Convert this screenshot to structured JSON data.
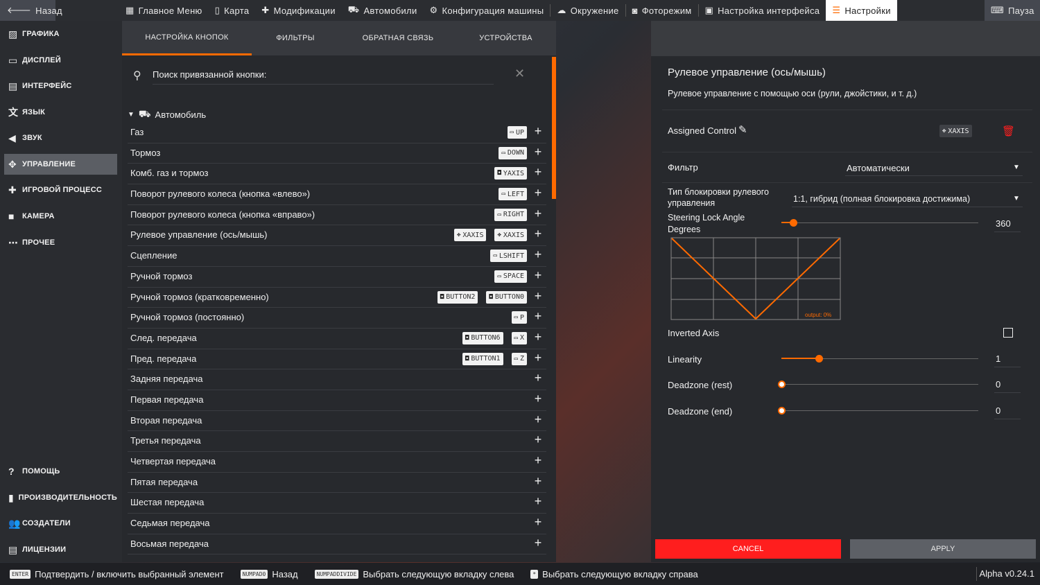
{
  "topbar": {
    "back": "Назад",
    "items": [
      {
        "label": "Главное Меню",
        "icon": "grid-icon"
      },
      {
        "label": "Карта",
        "icon": "map-icon"
      },
      {
        "label": "Модификации",
        "icon": "puzzle-icon"
      },
      {
        "label": "Автомобили",
        "icon": "car-icon"
      },
      {
        "label": "Конфигурация машины",
        "icon": "car-config-icon"
      },
      {
        "label": "Окружение",
        "icon": "weather-icon"
      },
      {
        "label": "Фоторежим",
        "icon": "camera-icon"
      },
      {
        "label": "Настройка интерфейса",
        "icon": "ui-apps-icon"
      },
      {
        "label": "Настройки",
        "icon": "settings-sliders-icon"
      }
    ],
    "pause": "Пауза"
  },
  "sidebar": {
    "items": [
      {
        "label": "ГРАФИКА",
        "icon": "image-icon"
      },
      {
        "label": "ДИСПЛЕЙ",
        "icon": "monitor-icon"
      },
      {
        "label": "ИНТЕРФЕЙС",
        "icon": "interface-icon"
      },
      {
        "label": "ЯЗЫК",
        "icon": "translate-icon"
      },
      {
        "label": "ЗВУК",
        "icon": "speaker-icon"
      },
      {
        "label": "УПРАВЛЕНИЕ",
        "icon": "gamepad-icon"
      },
      {
        "label": "ИГРОВОЙ ПРОЦЕСС",
        "icon": "puzzle-icon"
      },
      {
        "label": "КАМЕРА",
        "icon": "video-camera-icon"
      },
      {
        "label": "ПРОЧЕЕ",
        "icon": "more-icon"
      }
    ],
    "bottom_items": [
      {
        "label": "ПОМОЩЬ",
        "icon": "help-icon"
      },
      {
        "label": "ПРОИЗВОДИТЕЛЬНОСТЬ",
        "icon": "bar-chart-icon"
      },
      {
        "label": "СОЗДАТЕЛИ",
        "icon": "people-icon"
      },
      {
        "label": "ЛИЦЕНЗИИ",
        "icon": "document-icon"
      }
    ]
  },
  "main": {
    "tabs": [
      "НАСТРОЙКА КНОПОК",
      "ФИЛЬТРЫ",
      "ОБРАТНАЯ СВЯЗЬ",
      "УСТРОЙСТВА"
    ],
    "search_placeholder": "Поиск привязанной кнопки:",
    "category": "Автомобиль",
    "rows": [
      {
        "label": "Газ",
        "binds": [
          {
            "key": "UP",
            "icon": "keyboard-icon"
          }
        ]
      },
      {
        "label": "Тормоз",
        "binds": [
          {
            "key": "DOWN",
            "icon": "keyboard-icon"
          }
        ]
      },
      {
        "label": "Комб. газ и тормоз",
        "binds": [
          {
            "key": "YAXIS",
            "icon": "gamepad-icon"
          }
        ]
      },
      {
        "label": "Поворот рулевого колеса (кнопка «влево»)",
        "binds": [
          {
            "key": "LEFT",
            "icon": "keyboard-icon"
          }
        ]
      },
      {
        "label": "Поворот рулевого колеса (кнопка «вправо»)",
        "binds": [
          {
            "key": "RIGHT",
            "icon": "keyboard-icon"
          }
        ]
      },
      {
        "label": "Рулевое управление (ось/мышь)",
        "binds": [
          {
            "key": "XAXIS",
            "icon": "dpad-icon"
          },
          {
            "key": "XAXIS",
            "icon": "dpad-icon"
          }
        ]
      },
      {
        "label": "Сцепление",
        "binds": [
          {
            "key": "LSHIFT",
            "icon": "keyboard-icon"
          }
        ]
      },
      {
        "label": "Ручной тормоз",
        "binds": [
          {
            "key": "SPACE",
            "icon": "keyboard-icon"
          }
        ]
      },
      {
        "label": "Ручной тормоз (кратковременно)",
        "binds": [
          {
            "key": "BUTTON2",
            "icon": "gamepad-icon"
          },
          {
            "key": "BUTTON0",
            "icon": "gamepad-icon"
          }
        ]
      },
      {
        "label": "Ручной тормоз (постоянно)",
        "binds": [
          {
            "key": "P",
            "icon": "keyboard-icon"
          }
        ]
      },
      {
        "label": "След. передача",
        "binds": [
          {
            "key": "BUTTON6",
            "icon": "gamepad-icon"
          },
          {
            "key": "X",
            "icon": "keyboard-icon"
          }
        ]
      },
      {
        "label": "Пред. передача",
        "binds": [
          {
            "key": "BUTTON1",
            "icon": "gamepad-icon"
          },
          {
            "key": "Z",
            "icon": "keyboard-icon"
          }
        ]
      },
      {
        "label": "Задняя передача",
        "binds": []
      },
      {
        "label": "Первая передача",
        "binds": []
      },
      {
        "label": "Вторая передача",
        "binds": []
      },
      {
        "label": "Третья передача",
        "binds": []
      },
      {
        "label": "Четвертая передача",
        "binds": []
      },
      {
        "label": "Пятая передача",
        "binds": []
      },
      {
        "label": "Шестая передача",
        "binds": []
      },
      {
        "label": "Седьмая передача",
        "binds": []
      },
      {
        "label": "Восьмая передача",
        "binds": []
      }
    ]
  },
  "detail": {
    "title": "Рулевое управление (ось/мышь)",
    "description": "Рулевое управление с помощью оси (рули, джойстики, и т. д.)",
    "assigned_label": "Assigned Control",
    "assigned_key": "XAXIS",
    "filter_label": "Фильтр",
    "filter_value": "Автоматически",
    "lock_type_label_1": "Тип блокировки рулевого",
    "lock_type_label_2": "управления",
    "lock_type_value": "1:1, гибрид (полная блокировка достижима)",
    "steering_lock_label_1": "Steering Lock Angle",
    "steering_lock_label_2": "Degrees",
    "steering_lock_value": "360",
    "steering_lock_level": 0.06,
    "graph_output": "output: 0%",
    "inverted_label": "Inverted Axis",
    "inverted_checked": false,
    "linearity_label": "Linearity",
    "linearity_value": "1",
    "linearity_level": 0.19,
    "deadzone_rest_label": "Deadzone (rest)",
    "deadzone_rest_value": "0",
    "deadzone_rest_level": 0,
    "deadzone_end_label": "Deadzone (end)",
    "deadzone_end_value": "0",
    "deadzone_end_level": 0,
    "cancel": "CANCEL",
    "apply": "APPLY"
  },
  "bottombar": {
    "hints": [
      {
        "key": "ENTER",
        "text": "Подтвердить / включить выбранный элемент"
      },
      {
        "key": "NUMPAD0",
        "text": "Назад"
      },
      {
        "key": "NUMPADDIVIDE",
        "text": "Выбрать следующую вкладку слева"
      },
      {
        "key": "*",
        "text": "Выбрать следующую вкладку справа"
      }
    ],
    "version": "Alpha v0.24.1"
  },
  "colors": {
    "accent": "#ff6a00",
    "cancel": "#ff1e1e",
    "panel": "#27292d"
  }
}
